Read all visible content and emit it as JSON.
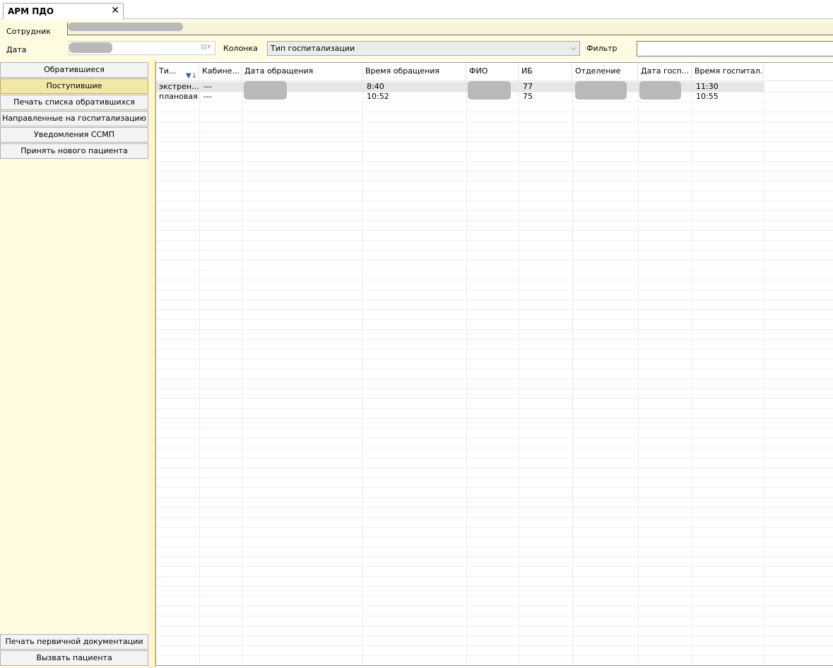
{
  "tab": {
    "title": "АРМ ПДО",
    "close": "✕"
  },
  "header": {
    "employee_label": "Сотрудник",
    "date_label": "Дата",
    "column_label": "Колонка",
    "column_value": "Тип госпитализации",
    "column_arrow": "⌵",
    "filter_label": "Фильтр",
    "filter_value": "",
    "calendar_icon": "▤▾"
  },
  "nav": {
    "top": [
      {
        "label": "Обратившиеся",
        "active": false
      },
      {
        "label": "Поступившие",
        "active": true
      },
      {
        "label": "Печать списка обратившихся",
        "active": false
      },
      {
        "label": "Направленные на госпитализацию",
        "active": false
      },
      {
        "label": "Уведомления ССМП",
        "active": false
      },
      {
        "label": "Принять нового пациента",
        "active": false
      }
    ],
    "bottom": [
      {
        "label": "Печать первичной документации"
      },
      {
        "label": "Вызвать пациента"
      }
    ]
  },
  "grid": {
    "filter_icon": "▼↓",
    "columns": [
      "Ти...",
      "Кабине...",
      "Дата обращения",
      "Время обращения",
      "ФИО",
      "ИБ",
      "Отделение",
      "Дата госп...",
      "Время госпитал..."
    ],
    "rows": [
      [
        "экстрен...",
        "---",
        "",
        "8:40",
        "",
        "77",
        "",
        "",
        "11:30"
      ],
      [
        "плановая",
        "---",
        "",
        "10:52",
        "",
        "75",
        "",
        "",
        "10:55"
      ]
    ]
  },
  "colors": {
    "panel_bg": "#fffbe1",
    "active_nav": "#f1e8a8",
    "selected_row": "#e6e6e6"
  }
}
